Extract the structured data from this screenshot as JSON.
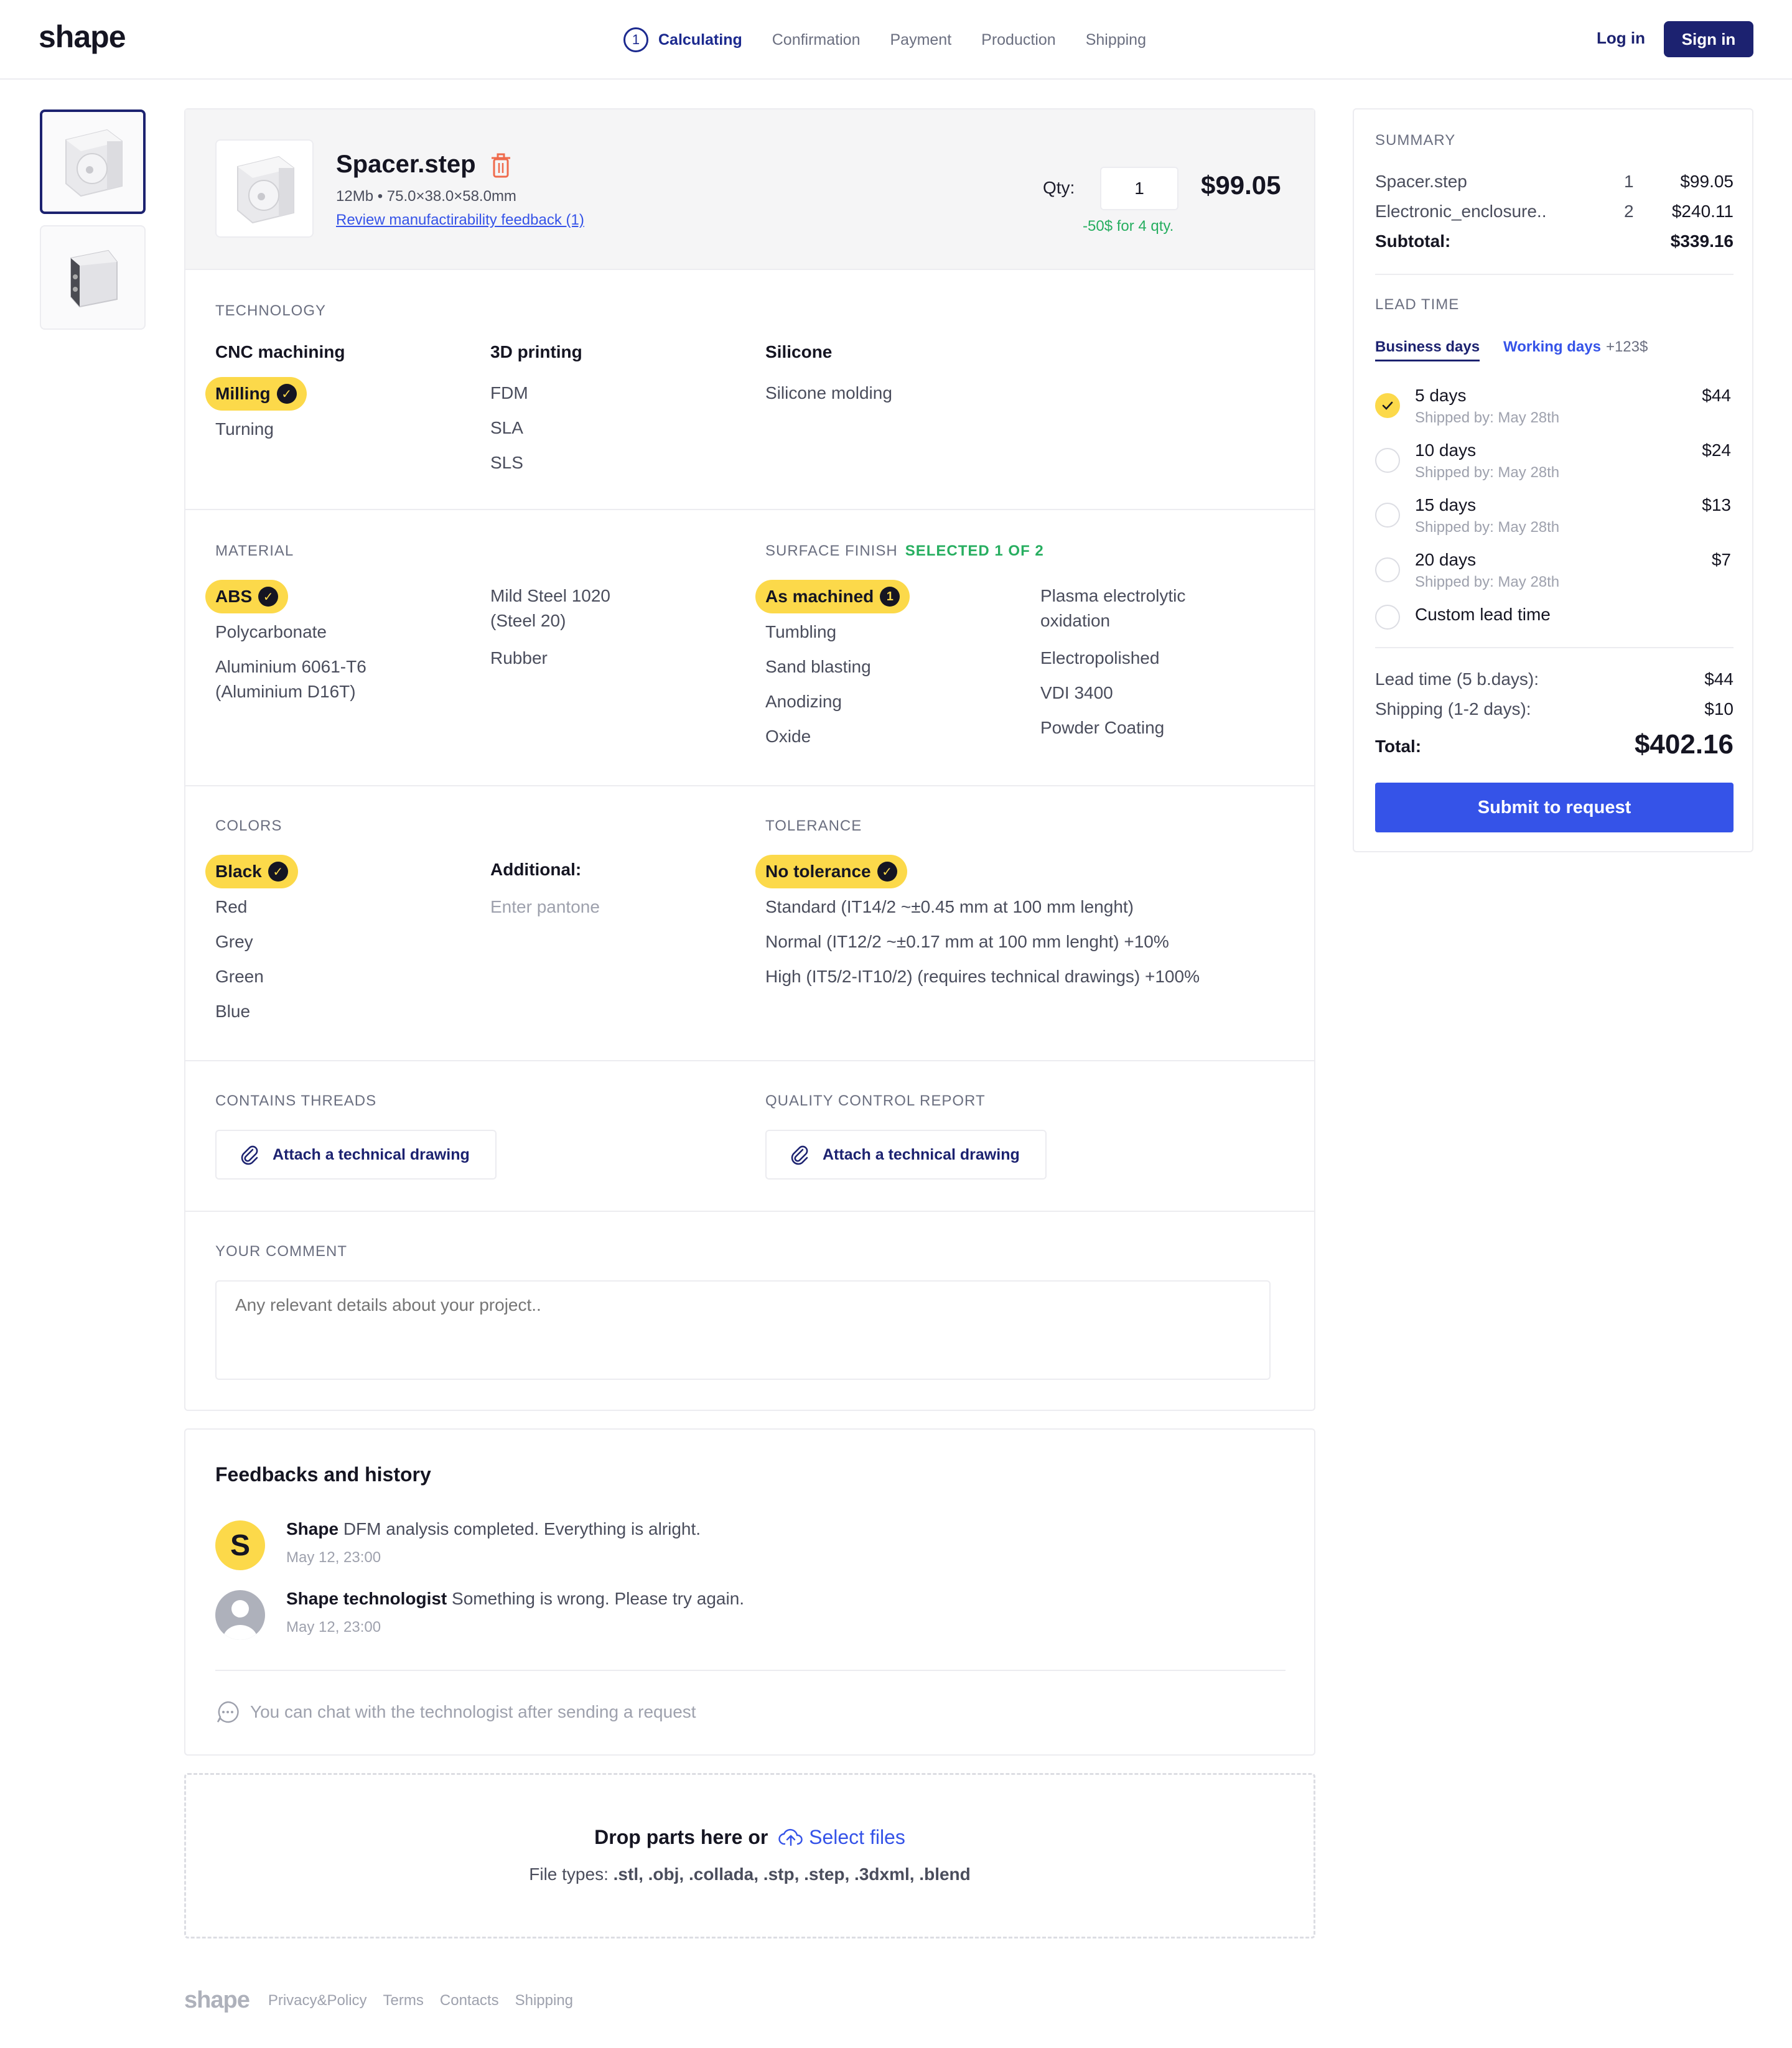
{
  "header": {
    "logo": "shape",
    "steps": [
      {
        "num": "1",
        "label": "Calculating"
      },
      {
        "label": "Confirmation"
      },
      {
        "label": "Payment"
      },
      {
        "label": "Production"
      },
      {
        "label": "Shipping"
      }
    ],
    "login": "Log in",
    "signin": "Sign in"
  },
  "part": {
    "name": "Spacer.step",
    "meta": "12Mb • 75.0×38.0×58.0mm",
    "feedback_link": "Review manufactirability feedback (1)",
    "qty_label": "Qty:",
    "qty": "1",
    "price": "$99.05",
    "discount": "-50$ for 4 qty."
  },
  "technology": {
    "label": "TECHNOLOGY",
    "cnc": {
      "head": "CNC machining",
      "selected": "Milling",
      "options": [
        "Turning"
      ]
    },
    "printing": {
      "head": "3D printing",
      "options": [
        "FDM",
        "SLA",
        "SLS"
      ]
    },
    "silicone": {
      "head": "Silicone",
      "options": [
        "Silicone molding"
      ]
    }
  },
  "material": {
    "label": "MATERIAL",
    "selected": "ABS",
    "col1": [
      "Polycarbonate",
      "Aluminium 6061-T6",
      "(Aluminium D16T)"
    ],
    "col2": [
      "Mild Steel 1020",
      "(Steel 20)",
      "Rubber"
    ]
  },
  "finish": {
    "label": "SURFACE FINISH",
    "selected_count": "SELECTED 1 OF 2",
    "selected": "As machined",
    "selected_badge": "1",
    "col1": [
      "Tumbling",
      "Sand blasting",
      "Anodizing",
      "Oxide"
    ],
    "col2": [
      "Plasma electrolytic",
      "oxidation",
      "Electropolished",
      "VDI 3400",
      "Powder Coating"
    ]
  },
  "colors": {
    "label": "COLORS",
    "selected": "Black",
    "options": [
      "Red",
      "Grey",
      "Green",
      "Blue"
    ],
    "additional_label": "Additional:",
    "additional_placeholder": "Enter pantone"
  },
  "tolerance": {
    "label": "TOLERANCE",
    "selected": "No tolerance",
    "options": [
      "Standard (IT14/2 ~±0.45 mm at 100 mm lenght)",
      "Normal (IT12/2 ~±0.17 mm at 100 mm lenght) +10%",
      "High (IT5/2-IT10/2) (requires technical drawings) +100%"
    ]
  },
  "threads": {
    "label": "CONTAINS THREADS",
    "button": "Attach a technical drawing"
  },
  "qc": {
    "label": "QUALITY CONTROL REPORT",
    "button": "Attach a technical drawing"
  },
  "comment": {
    "label": "YOUR COMMENT",
    "placeholder": "Any relevant details about your project.."
  },
  "feedback": {
    "title": "Feedbacks and history",
    "items": [
      {
        "avatar": "S",
        "author": "Shape",
        "text": "DFM analysis completed. Everything is alright.",
        "time": "May 12, 23:00"
      },
      {
        "author": "Shape technologist",
        "text": "Something is wrong. Please try again.",
        "time": "May 12, 23:00"
      }
    ],
    "chat_note": "You can chat with the technologist after sending a request"
  },
  "dropzone": {
    "text": "Drop parts here or",
    "select": "Select files",
    "types_label": "File types:",
    "types": ".stl, .obj, .collada, .stp, .step, .3dxml, .blend"
  },
  "footer": {
    "logo": "shape",
    "links": [
      "Privacy&Policy",
      "Terms",
      "Contacts",
      "Shipping"
    ]
  },
  "summary": {
    "label": "SUMMARY",
    "items": [
      {
        "name": "Spacer.step",
        "qty": "1",
        "price": "$99.05"
      },
      {
        "name": "Electronic_enclosure..",
        "qty": "2",
        "price": "$240.11"
      }
    ],
    "subtotal_label": "Subtotal:",
    "subtotal": "$339.16",
    "lead_label": "LEAD TIME",
    "tab_business": "Business days",
    "tab_working": "Working days",
    "tab_working_extra": "+123$",
    "options": [
      {
        "name": "5 days",
        "ship": "Shipped by: May 28th",
        "price": "$44",
        "selected": true
      },
      {
        "name": "10 days",
        "ship": "Shipped by: May 28th",
        "price": "$24"
      },
      {
        "name": "15 days",
        "ship": "Shipped by: May 28th",
        "price": "$13"
      },
      {
        "name": "20 days",
        "ship": "Shipped by: May 28th",
        "price": "$7"
      },
      {
        "name": "Custom lead time"
      }
    ],
    "lead_cost_label": "Lead time (5 b.days):",
    "lead_cost": "$44",
    "shipping_label": "Shipping (1-2 days):",
    "shipping": "$10",
    "total_label": "Total:",
    "total": "$402.16",
    "submit": "Submit to request"
  },
  "colors_theme": {
    "accent": "#3553e8",
    "brand": "#1c2270",
    "highlight": "#fcd94a",
    "success": "#27ae60"
  }
}
